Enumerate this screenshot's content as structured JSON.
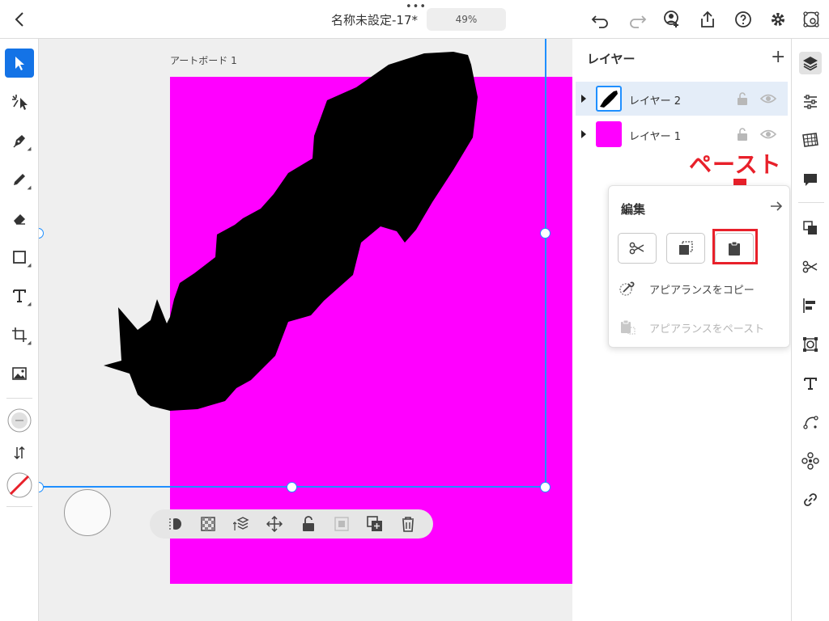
{
  "topbar": {
    "dots": "•••",
    "doc_title": "名称未設定-17*",
    "zoom": "49%"
  },
  "canvas": {
    "artboard_label": "アートボード 1",
    "artboard_color": "#ff00ff",
    "selection_color": "#1f8fff"
  },
  "layers_panel": {
    "title": "レイヤー",
    "add": "+",
    "layers": [
      {
        "name": "レイヤー 2",
        "active": true
      },
      {
        "name": "レイヤー 1",
        "active": false
      }
    ]
  },
  "edit_popup": {
    "title": "編集",
    "buttons": [
      "cut-icon",
      "copy-icon",
      "paste-icon"
    ],
    "copy_appearance": "アピアランスをコピー",
    "paste_appearance": "アピアランスをペースト"
  },
  "annotation": {
    "label": "ペースト",
    "color": "#e8202a"
  },
  "colors": {
    "accent": "#1473e6",
    "annotation_red": "#e8202a"
  }
}
